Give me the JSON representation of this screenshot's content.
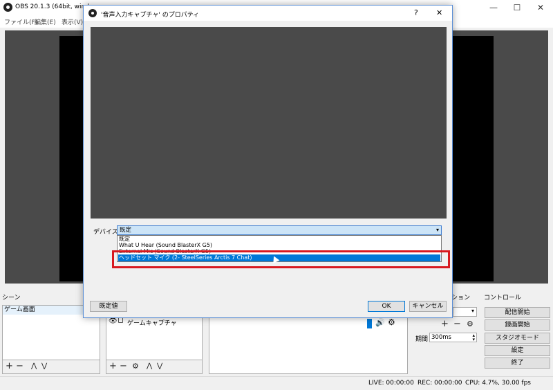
{
  "app": {
    "title": "OBS 20.1.3 (64bit, window",
    "window_controls": {
      "minimize": "—",
      "maximize": "☐",
      "close": "✕"
    }
  },
  "menu": {
    "items": [
      "ファイル(F)",
      "編集(E)",
      "表示(V)"
    ]
  },
  "scenes": {
    "header": "シーン",
    "items": [
      "ゲーム画面"
    ]
  },
  "sources": {
    "items": [
      "ゲームキャプチャ"
    ]
  },
  "transition": {
    "header": "ション",
    "duration_label": "期間",
    "duration_value": "300ms"
  },
  "controls": {
    "header": "コントロール",
    "buttons": [
      "配信開始",
      "録画開始",
      "スタジオモード",
      "設定",
      "終了"
    ]
  },
  "dialog": {
    "title": "'音声入力キャプチャ' のプロパティ",
    "help": "?",
    "close": "✕",
    "device_label": "デバイス",
    "device_selected": "既定",
    "device_options": [
      "既定",
      "What U Hear (Sound BlasterX G5)",
      "External Mic (Sound BlasterX G5)",
      "ヘッドセット マイク (2- SteelSeries Arctis 7 Chat)"
    ],
    "highlighted_index": 3,
    "defaults_button": "既定値",
    "ok_button": "OK",
    "cancel_button": "キャンセル"
  },
  "status": {
    "live": "LIVE: 00:00:00",
    "rec": "REC: 00:00:00",
    "cpu": "CPU: 4.7%, 30.00 fps"
  },
  "colors": {
    "accent": "#0078d7",
    "highlight_box": "#d71920",
    "preview": "#4a4a4a"
  }
}
